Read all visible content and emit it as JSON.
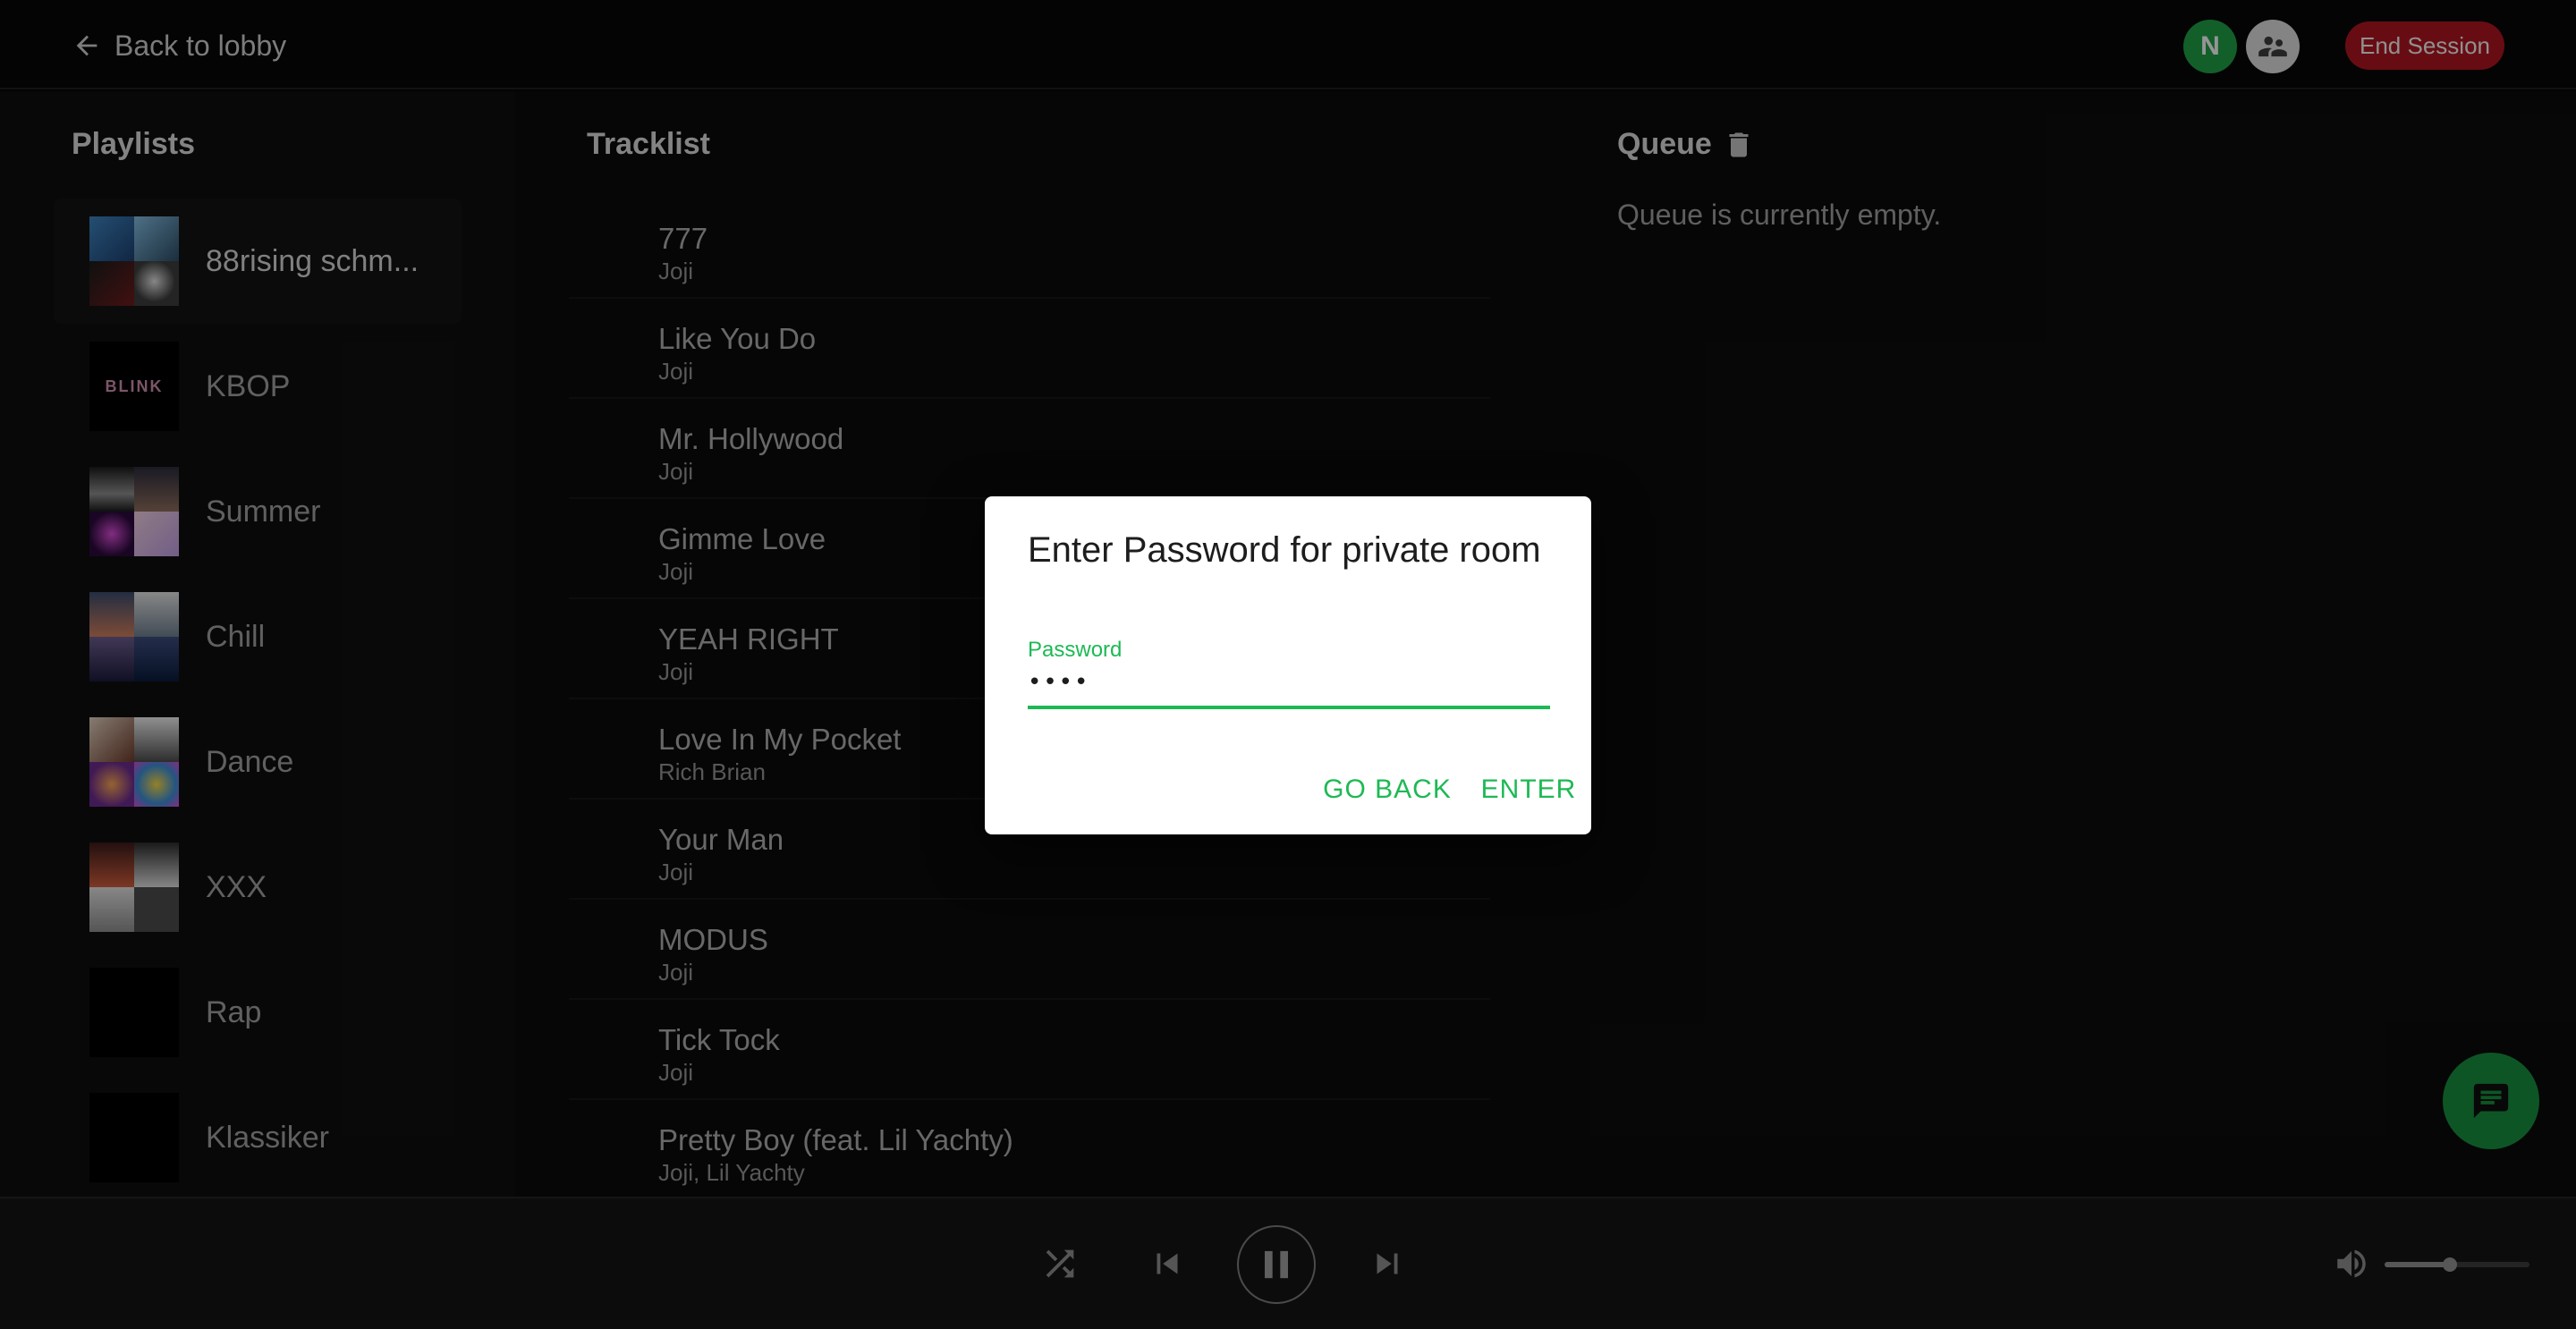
{
  "header": {
    "back_label": "Back to lobby",
    "avatar_initial": "N",
    "end_session_label": "End Session"
  },
  "sidebar": {
    "title": "Playlists",
    "playlists": [
      {
        "name": "88rising schm..."
      },
      {
        "name": "KBOP",
        "art_text": "BLINK"
      },
      {
        "name": "Summer"
      },
      {
        "name": "Chill"
      },
      {
        "name": "Dance"
      },
      {
        "name": "XXX"
      },
      {
        "name": "Rap"
      },
      {
        "name": "Klassiker"
      }
    ]
  },
  "tracklist": {
    "title": "Tracklist",
    "tracks": [
      {
        "title": "777",
        "artist": "Joji"
      },
      {
        "title": "Like You Do",
        "artist": "Joji"
      },
      {
        "title": "Mr. Hollywood",
        "artist": "Joji"
      },
      {
        "title": "Gimme Love",
        "artist": "Joji"
      },
      {
        "title": "YEAH RIGHT",
        "artist": "Joji"
      },
      {
        "title": "Love In My Pocket",
        "artist": "Rich Brian"
      },
      {
        "title": "Your Man",
        "artist": "Joji"
      },
      {
        "title": "MODUS",
        "artist": "Joji"
      },
      {
        "title": "Tick Tock",
        "artist": "Joji"
      },
      {
        "title": "Pretty Boy (feat. Lil Yachty)",
        "artist": "Joji, Lil Yachty"
      }
    ]
  },
  "queue": {
    "title": "Queue",
    "empty_message": "Queue is currently empty."
  },
  "player": {
    "volume_level": 0.45
  },
  "dialog": {
    "title": "Enter Password for private room",
    "password_label": "Password",
    "password_value": "abcd",
    "go_back_label": "GO BACK",
    "enter_label": "ENTER"
  },
  "colors": {
    "accent": "#1db954",
    "end_session": "#a8141f",
    "chat_fab": "#178a3c"
  }
}
